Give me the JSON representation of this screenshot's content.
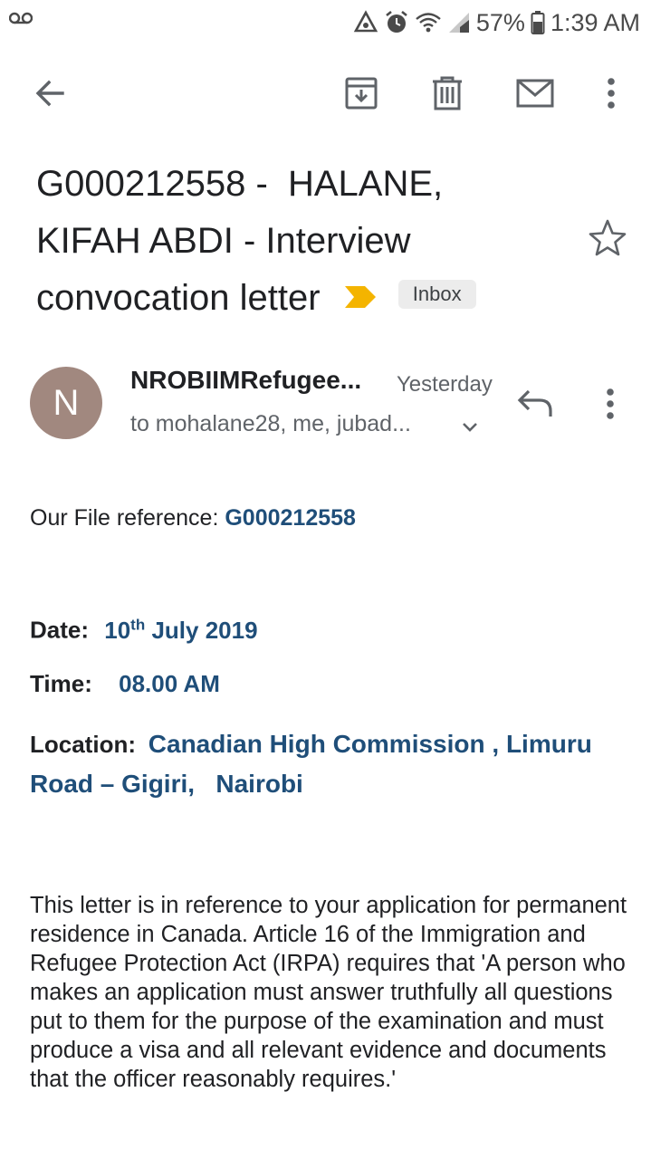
{
  "status_bar": {
    "battery": "57%",
    "time": "1:39 AM",
    "icons": [
      "voicemail-icon",
      "data-saver-icon",
      "alarm-icon",
      "wifi-icon",
      "signal-icon",
      "battery-icon"
    ]
  },
  "toolbar": {
    "icons": [
      "back-arrow-icon",
      "archive-icon",
      "delete-icon",
      "mark-unread-icon",
      "more-vert-icon"
    ]
  },
  "email": {
    "subject_line1": "G000212558 -  HALANE,",
    "subject_line2": "KIFAH ABDI - Interview",
    "subject_line3": "convocation letter",
    "label": "Inbox",
    "sender_initial": "N",
    "sender_name": "NROBIIMRefugee...",
    "date": "Yesterday",
    "recipients": "to mohalane28, me, jubad...",
    "colors": {
      "avatar": "#a1887f",
      "important_marker": "#f4b400",
      "link_blue": "#1f4e79"
    }
  },
  "body": {
    "file_ref_label": "Our File reference: ",
    "file_ref_value": "G000212558",
    "date_label": "Date:",
    "date_day": "10",
    "date_suffix": "th",
    "date_rest": " July 2019",
    "time_label": "Time:",
    "time_value": "08.00 AM",
    "location_label": "Location:",
    "location_value_1": "Canadian High Commission , Limuru",
    "location_value_2": "Road – Gigiri,   Nairobi",
    "paragraph": "This letter is in reference to your application for permanent residence in Canada. Article 16 of the Immigration and Refugee Protection Act (IRPA) requires that 'A person who makes an application must answer truthfully all questions put to them for the purpose of the examination and must produce a visa and all relevant evidence and documents that the officer reasonably requires.'"
  }
}
